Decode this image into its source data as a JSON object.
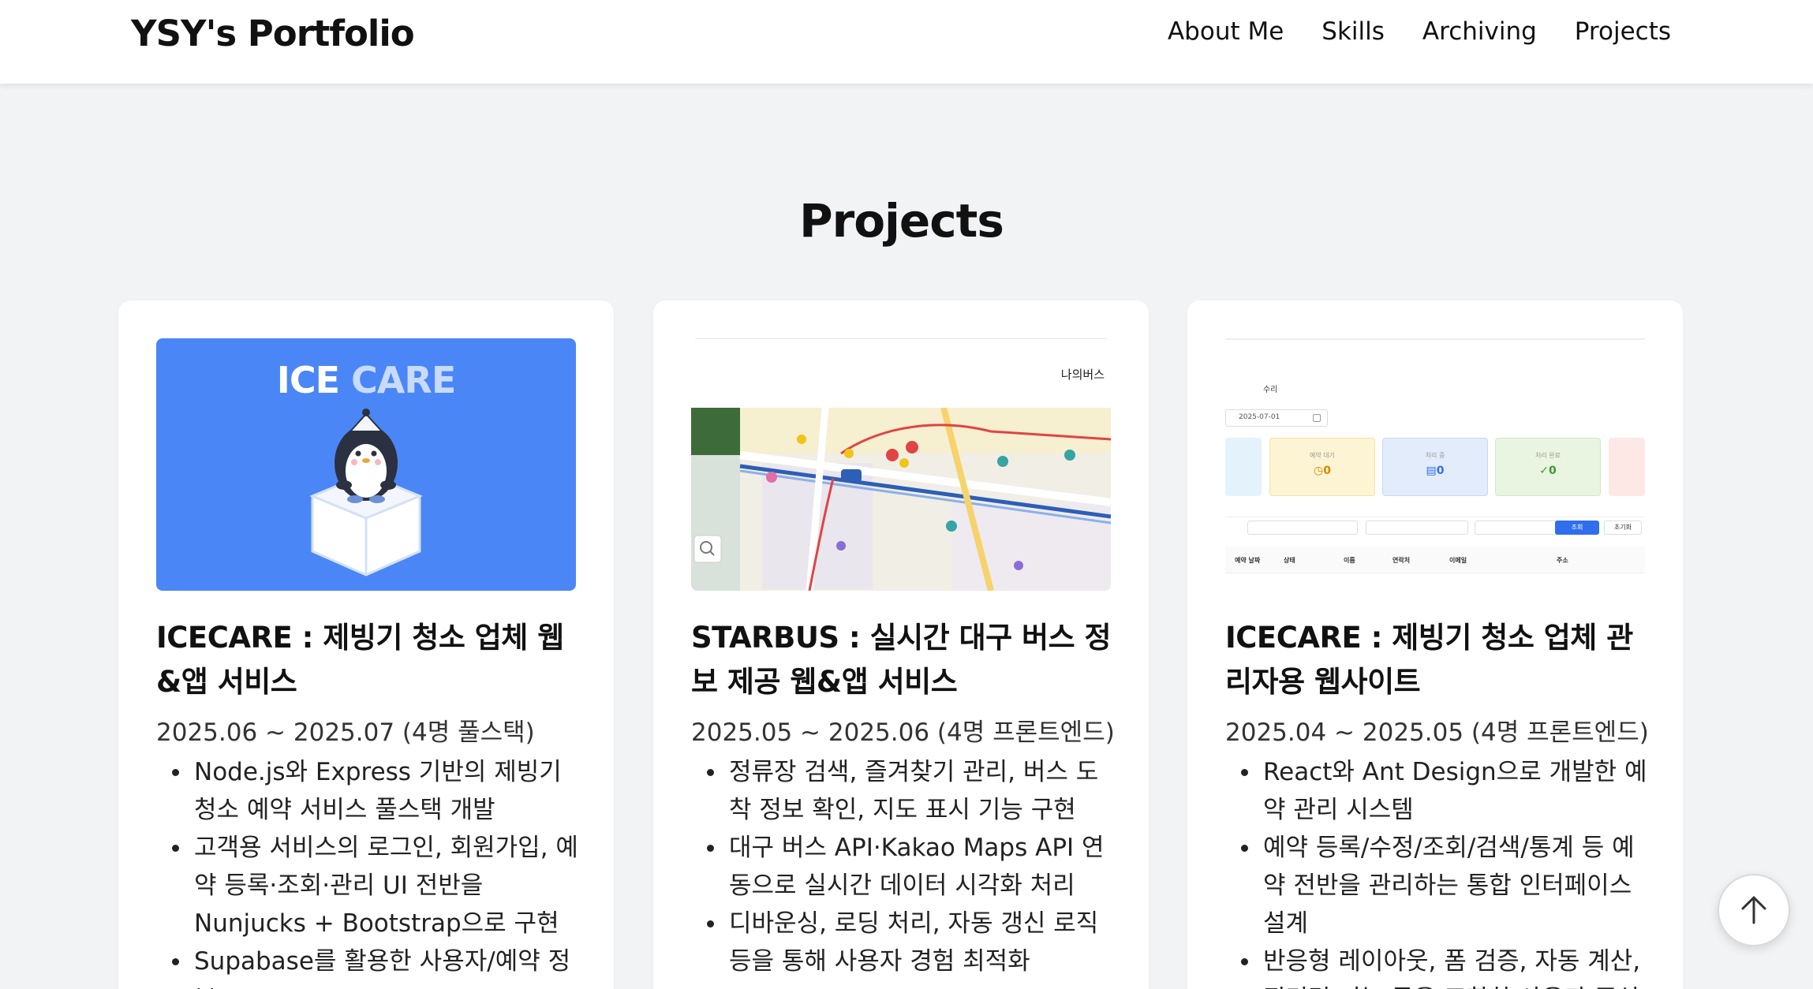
{
  "header": {
    "brand": "YSY's Portfolio",
    "nav": [
      "About Me",
      "Skills",
      "Archiving",
      "Projects"
    ]
  },
  "section_title": "Projects",
  "projects": [
    {
      "thumb_logo_white": "ICE",
      "thumb_logo_light": "CARE",
      "title": "ICECARE : 제빙기 청소 업체 웹&앱 서비스",
      "period": "2025.06 ~ 2025.07 (4명 풀스택)",
      "items": [
        "Node.js와 Express 기반의 제빙기 청소 예약 서비스 풀스택 개발",
        "고객용 서비스의 로그인, 회원가입, 예약 등록·조회·관리 UI 전반을 Nunjucks + Bootstrap으로 구현",
        "Supabase를 활용한 사용자/예약 정보"
      ]
    },
    {
      "thumb_header": "나의버스",
      "title": "STARBUS : 실시간 대구 버스 정보 제공 웹&앱 서비스",
      "period": "2025.05 ~ 2025.06 (4명 프론트엔드)",
      "items": [
        "정류장 검색, 즐겨찾기 관리, 버스 도착 정보 확인, 지도 표시 기능 구현",
        "대구 버스 API·Kakao Maps API 연동으로 실시간 데이터 시각화 처리",
        "디바운싱, 로딩 처리, 자동 갱신 로직 등을 통해 사용자 경험 최적화"
      ]
    },
    {
      "thumb_tab": "수리",
      "thumb_date": "2025-07-01",
      "thumb_stats": [
        {
          "label": "예약 대기",
          "value": "0"
        },
        {
          "label": "처리 중",
          "value": "0"
        },
        {
          "label": "처리 완료",
          "value": "0"
        }
      ],
      "thumb_search": "조회",
      "thumb_reset": "초기화",
      "thumb_columns": [
        "예약 날짜",
        "상태",
        "이름",
        "연락처",
        "이메일",
        "주소"
      ],
      "title": "ICECARE : 제빙기 청소 업체 관리자용 웹사이트",
      "period": "2025.04 ~ 2025.05 (4명 프론트엔드)",
      "items": [
        "React와 Ant Design으로 개발한 예약 관리 시스템",
        "예약 등록/수정/조회/검색/통계 등 예약 전반을 관리하는 통합 인터페이스 설계",
        "반응형 레이아웃, 폼 검증, 자동 계산, 필터링 기능 등을 포함한 사용자 중심"
      ]
    }
  ],
  "colors": {
    "ice_blue": "#4a86f5",
    "page_bg": "#f2f3f5",
    "stat_yellow": "#fdf4d3",
    "stat_blue": "#e3ecfb",
    "stat_green": "#e9f5e0",
    "button_blue": "#2f6fed"
  },
  "icons": {
    "scroll_top": "arrow-up-icon",
    "mascot": "penguin-on-ice-cube",
    "map_search": "search-icon"
  }
}
